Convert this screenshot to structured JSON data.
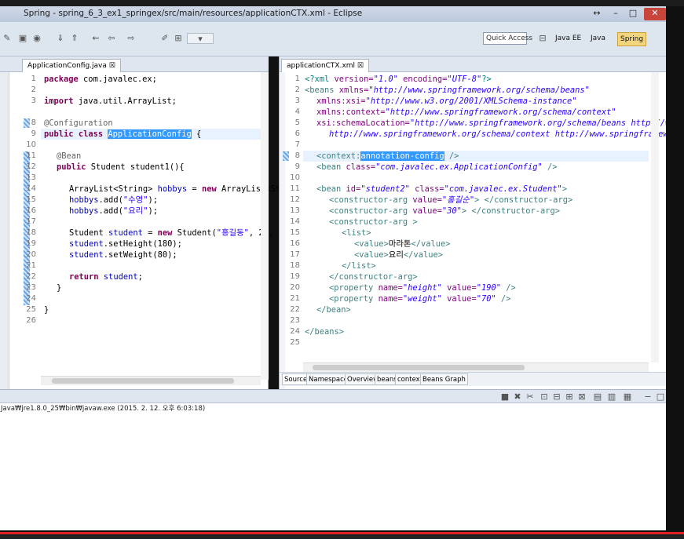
{
  "window": {
    "title": "Spring - spring_6_3_ex1_springex/src/main/resources/applicationCTX.xml - Eclipse",
    "close_label": "✕",
    "min_label": "–",
    "max_label": "□",
    "restore_label": "↔"
  },
  "toolbar": {
    "quick_access": "Quick Access",
    "perspectives": [
      "Java EE",
      "Java",
      "Spring"
    ],
    "active_perspective": "Spring"
  },
  "left_editor": {
    "tab_label": "ApplicationConfig.java ☒",
    "line_numbers": [
      "1",
      "2",
      "3",
      "8",
      "9",
      "10",
      "11",
      "12",
      "13",
      "14",
      "15",
      "16",
      "17",
      "18",
      "19",
      "20",
      "21",
      "22",
      "23",
      "24",
      "25",
      "26"
    ],
    "lines": {
      "l1_kw": "package",
      "l1_rest": " com.javalec.ex;",
      "l3_kw": "import",
      "l3_rest": " java.util.ArrayList;",
      "l8": "@Configuration",
      "l9_kw1": "public",
      "l9_kw2": "class",
      "l9_sel": "ApplicationConfig",
      "l9_rest": " {",
      "l11": "@Bean",
      "l12_kw": "public",
      "l12_rest": " Student student1(){",
      "l14_a": "ArrayList<String> ",
      "l14_var": "hobbys",
      "l14_b": " = ",
      "l14_kw": "new",
      "l14_c": " ArrayList<String",
      "l15_var": "hobbys",
      "l15_a": ".add(",
      "l15_str": "\"수영\"",
      "l15_b": ");",
      "l16_var": "hobbys",
      "l16_a": ".add(",
      "l16_str": "\"요리\"",
      "l16_b": ");",
      "l18_a": "Student ",
      "l18_var": "student",
      "l18_b": " = ",
      "l18_kw": "new",
      "l18_c": " Student(",
      "l18_str": "\"홍길동\"",
      "l18_d": ", 20, hob",
      "l19_var": "student",
      "l19_a": ".setHeight(180);",
      "l20_var": "student",
      "l20_a": ".setWeight(80);",
      "l22_kw": "return",
      "l22_var": " student",
      "l22_a": ";",
      "l24": "}",
      "l25": "}"
    }
  },
  "right_editor": {
    "tab_label": "applicationCTX.xml ☒",
    "line_numbers": [
      "1",
      "2",
      "3",
      "4",
      "5",
      "6",
      "7",
      "8",
      "9",
      "10",
      "11",
      "12",
      "13",
      "14",
      "15",
      "16",
      "17",
      "18",
      "19",
      "20",
      "21",
      "22",
      "23",
      "24",
      "25"
    ],
    "lines": {
      "x1_pi": "<?xml",
      "x1_a1": " version=",
      "x1_v1": "\"1.0\"",
      "x1_a2": " encoding=",
      "x1_v2": "\"UTF-8\"",
      "x1_end": "?>",
      "x2_tag": "<beans",
      "x2_a": " xmlns=",
      "x2_v": "\"http://www.springframework.org/schema/beans\"",
      "x3_a": "xmlns:xsi=",
      "x3_v": "\"http://www.w3.org/2001/XMLSchema-instance\"",
      "x4_a": "xmlns:context=",
      "x4_v": "\"http://www.springframework.org/schema/context\"",
      "x5_a": "xsi:schemaLocation=",
      "x5_v": "\"http://www.springframework.org/schema/beans http://www.sprin",
      "x6_v": "http://www.springframework.org/schema/context http://www.springframework.org/",
      "x8_tag": "<context:",
      "x8_sel": "annotation-config",
      "x8_end": " />",
      "x9_tag": "<bean",
      "x9_a": " class=",
      "x9_v": "\"com.javalec.ex.ApplicationConfig\"",
      "x9_end": " />",
      "x11_tag": "<bean",
      "x11_a1": " id=",
      "x11_v1": "\"student2\"",
      "x11_a2": " class=",
      "x11_v2": "\"com.javalec.ex.Student\"",
      "x11_end": ">",
      "x12_tag": "<constructor-arg",
      "x12_a": " value=",
      "x12_v": "\"홍길순\"",
      "x12_end": "> </constructor-arg>",
      "x13_tag": "<constructor-arg",
      "x13_a": " value=",
      "x13_v": "\"30\"",
      "x13_end": "> </constructor-arg>",
      "x14_tag": "<constructor-arg >",
      "x15_tag": "<list>",
      "x16_tag1": "<value>",
      "x16_text": "마라톤",
      "x16_tag2": "</value>",
      "x17_tag1": "<value>",
      "x17_text": "요리",
      "x17_tag2": "</value>",
      "x18_tag": "</list>",
      "x19_tag": "</constructor-arg>",
      "x20_tag": "<property",
      "x20_a1": " name=",
      "x20_v1": "\"height\"",
      "x20_a2": " value=",
      "x20_v2": "\"190\"",
      "x20_end": " />",
      "x21_tag": "<property",
      "x21_a1": " name=",
      "x21_v1": "\"weight\"",
      "x21_a2": " value=",
      "x21_v2": "\"70\"",
      "x21_end": " />",
      "x22_tag": "</bean>",
      "x24_tag": "</beans>"
    },
    "bottom_tabs": [
      "Source",
      "Namespaces",
      "Overview",
      "beans",
      "context",
      "Beans Graph"
    ],
    "active_bottom_tab": "Source"
  },
  "console": {
    "launch_info": "Java₩jre1.8.0_25₩bin₩javaw.exe (2015. 2. 12. 오후 6:03:18)"
  },
  "colors": {
    "selection": "#3399ff",
    "keyword": "#7f0055",
    "xml_tag": "#3f7f7f",
    "xml_attr": "#7f007f",
    "xml_value": "#2a00ff",
    "progress": "#e02020",
    "close_button": "#c9443b"
  }
}
